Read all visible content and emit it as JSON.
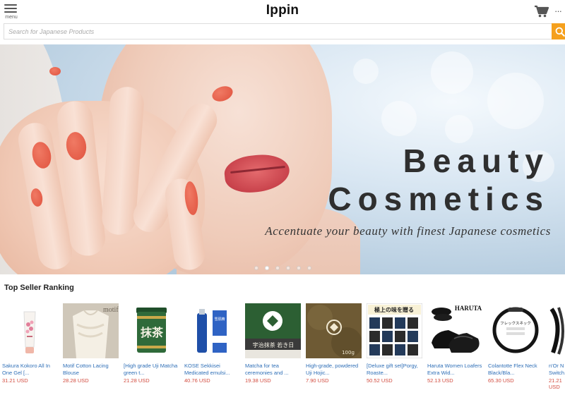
{
  "header": {
    "menu_label": "menu",
    "logo": "Ippin",
    "cart_icon": "cart-icon",
    "more_icon": "more-icon"
  },
  "search": {
    "placeholder": "Search for Japanese Products",
    "value": "",
    "button_icon": "search-icon"
  },
  "banner": {
    "title_line1": "Beauty",
    "title_line2": "Cosmetics",
    "subtitle": "Accentuate your beauty with finest Japanese cosmetics",
    "slide_count": 6,
    "active_slide": 2
  },
  "ranking": {
    "title": "Top Seller Ranking",
    "products": [
      {
        "name": "Sakura Kokoro All In One Gel [...",
        "price": "31.21 USD"
      },
      {
        "name": "Motif Cotton Lacing Blouse",
        "price": "28.28 USD",
        "image_text": "motif"
      },
      {
        "name": "[High grade Uji Matcha green t...",
        "price": "21.28 USD",
        "image_text": "抹茶"
      },
      {
        "name": "KOSE Sekkisei Medicated emulsi...",
        "price": "40.76 USD",
        "image_text": "雪肌精"
      },
      {
        "name": "Matcha for tea ceremonies and ...",
        "price": "19.38 USD",
        "image_text": "宇治抹茶 若き日"
      },
      {
        "name": "High-grade, powdered Uji Hojic...",
        "price": "7.90 USD",
        "image_text": "100g"
      },
      {
        "name": "[Deluxe gift set]Porgy, Roaste...",
        "price": "50.52 USD",
        "image_text": "極上の味を贈る"
      },
      {
        "name": "Haruta Women Loafers Extra Wid...",
        "price": "52.13 USD",
        "image_text": "HARUTA"
      },
      {
        "name": "Colantotte Flex Neck Black/Bla...",
        "price": "65.30 USD",
        "image_text": "フレックスネック"
      },
      {
        "name": "n'Or N Switch...",
        "price": "21.21 USD"
      }
    ]
  },
  "colors": {
    "accent": "#f5a01d",
    "link": "#2f6fb7",
    "price": "#d24b3e"
  }
}
